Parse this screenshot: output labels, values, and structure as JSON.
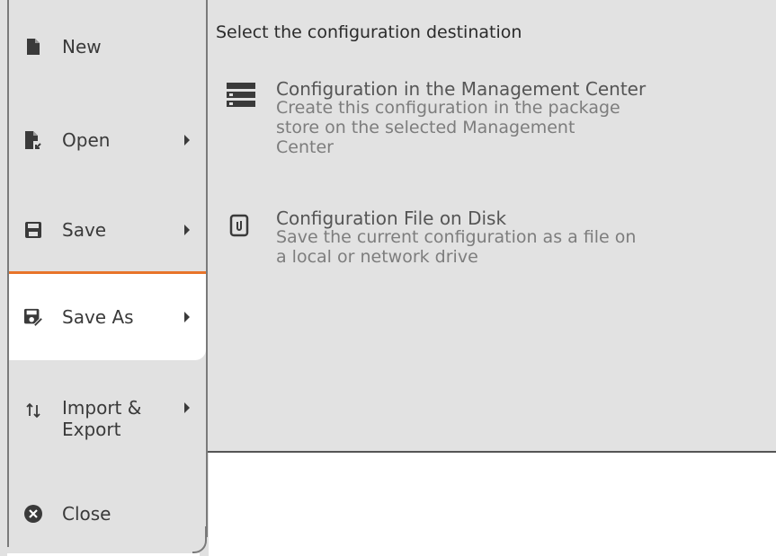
{
  "menu": {
    "items": [
      {
        "label": "New",
        "icon": "file-icon"
      },
      {
        "label": "Open",
        "icon": "file-open-icon"
      },
      {
        "label": "Save",
        "icon": "floppy-icon"
      },
      {
        "label": "Save As",
        "icon": "floppy-edit-icon"
      },
      {
        "label": "Import & Export",
        "label_line1": "Import &",
        "label_line2": "Export",
        "icon": "import-export-icon"
      },
      {
        "label": "Close",
        "icon": "close-circle-icon"
      }
    ],
    "active_item": "Save As",
    "accent_color": "#e8742a"
  },
  "panel": {
    "title": "Select the configuration destination",
    "options": [
      {
        "title": "Configuration in the Management Center",
        "description": "Create this configuration in the package store on the selected Management Center",
        "desc_line1": "Create this configuration in the package",
        "desc_line2": "store on the selected Management",
        "desc_line3": "Center",
        "icon": "server-list-icon"
      },
      {
        "title": "Configuration File on Disk",
        "description": "Save the current configuration as a file on a local or network drive",
        "desc_line1": "Save the current configuration as a file on",
        "desc_line2": "a local or network drive",
        "icon": "file-clip-icon"
      }
    ]
  }
}
